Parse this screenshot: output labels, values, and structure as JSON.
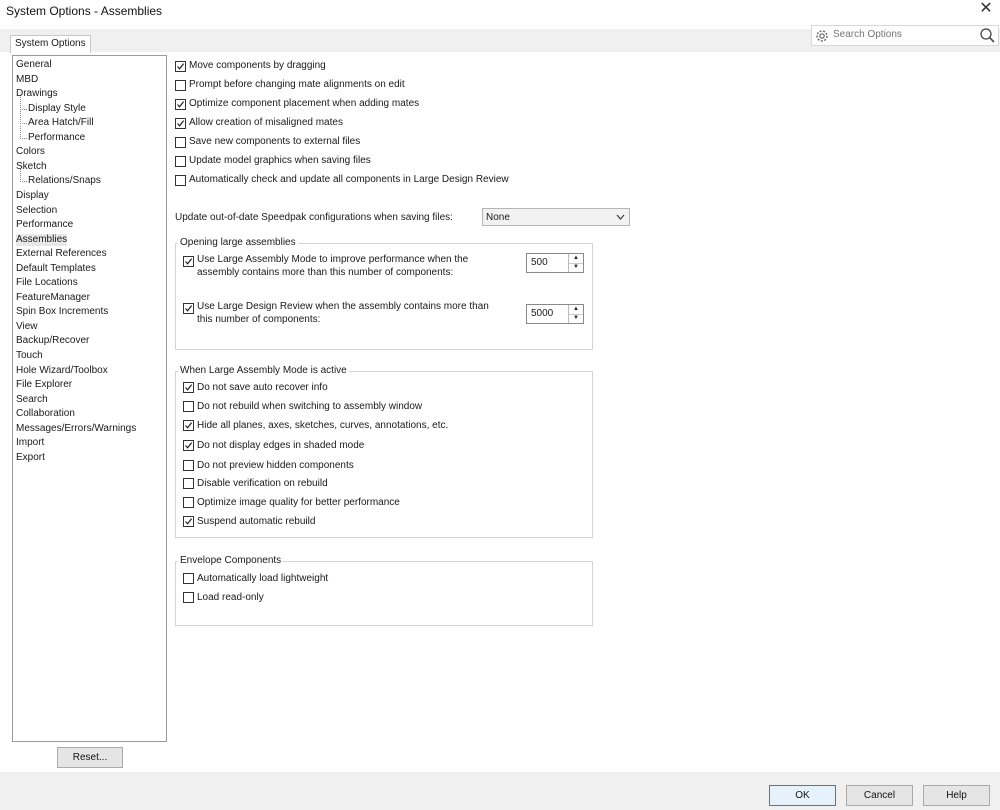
{
  "window": {
    "title": "System Options - Assemblies",
    "close_glyph": "✕"
  },
  "tab": {
    "label": "System Options"
  },
  "search": {
    "placeholder": "Search Options"
  },
  "tree": [
    {
      "label": "General",
      "sub": false,
      "selected": false
    },
    {
      "label": "MBD",
      "sub": false,
      "selected": false
    },
    {
      "label": "Drawings",
      "sub": false,
      "selected": false
    },
    {
      "label": "Display Style",
      "sub": true,
      "selected": false
    },
    {
      "label": "Area Hatch/Fill",
      "sub": true,
      "selected": false
    },
    {
      "label": "Performance",
      "sub": true,
      "selected": false
    },
    {
      "label": "Colors",
      "sub": false,
      "selected": false
    },
    {
      "label": "Sketch",
      "sub": false,
      "selected": false
    },
    {
      "label": "Relations/Snaps",
      "sub": true,
      "selected": false
    },
    {
      "label": "Display",
      "sub": false,
      "selected": false
    },
    {
      "label": "Selection",
      "sub": false,
      "selected": false
    },
    {
      "label": "Performance",
      "sub": false,
      "selected": false
    },
    {
      "label": "Assemblies",
      "sub": false,
      "selected": true
    },
    {
      "label": "External References",
      "sub": false,
      "selected": false
    },
    {
      "label": "Default Templates",
      "sub": false,
      "selected": false
    },
    {
      "label": "File Locations",
      "sub": false,
      "selected": false
    },
    {
      "label": "FeatureManager",
      "sub": false,
      "selected": false
    },
    {
      "label": "Spin Box Increments",
      "sub": false,
      "selected": false
    },
    {
      "label": "View",
      "sub": false,
      "selected": false
    },
    {
      "label": "Backup/Recover",
      "sub": false,
      "selected": false
    },
    {
      "label": "Touch",
      "sub": false,
      "selected": false
    },
    {
      "label": "Hole Wizard/Toolbox",
      "sub": false,
      "selected": false
    },
    {
      "label": "File Explorer",
      "sub": false,
      "selected": false
    },
    {
      "label": "Search",
      "sub": false,
      "selected": false
    },
    {
      "label": "Collaboration",
      "sub": false,
      "selected": false
    },
    {
      "label": "Messages/Errors/Warnings",
      "sub": false,
      "selected": false
    },
    {
      "label": "Import",
      "sub": false,
      "selected": false
    },
    {
      "label": "Export",
      "sub": false,
      "selected": false
    }
  ],
  "top_options": [
    {
      "label": "Move components by dragging",
      "checked": true
    },
    {
      "label": "Prompt before changing mate alignments on edit",
      "checked": false
    },
    {
      "label": "Optimize component placement when adding mates",
      "checked": true
    },
    {
      "label": "Allow creation of misaligned mates",
      "checked": true
    },
    {
      "label": "Save new components to external files",
      "checked": false
    },
    {
      "label": "Update model graphics when saving files",
      "checked": false
    },
    {
      "label": "Automatically check and update all components in Large Design Review",
      "checked": false
    }
  ],
  "speedpak": {
    "label": "Update out-of-date Speedpak configurations when saving files:",
    "value": "None"
  },
  "opening": {
    "title": "Opening large assemblies",
    "lam": {
      "line1": "Use Large Assembly Mode to improve performance when the",
      "line2": "assembly contains more than this number of components:",
      "checked": true,
      "value": "500"
    },
    "ldr": {
      "line1": "Use Large Design Review when the assembly contains more than",
      "line2": "this number of components:",
      "checked": true,
      "value": "5000"
    }
  },
  "lam_active": {
    "title": "When Large Assembly Mode is active",
    "items": [
      {
        "label": "Do not save auto recover info",
        "checked": true
      },
      {
        "label": "Do not rebuild when switching to assembly window",
        "checked": false
      },
      {
        "label": "Hide all planes, axes, sketches, curves, annotations, etc.",
        "checked": true
      },
      {
        "label": "Do not display edges in shaded mode",
        "checked": true
      },
      {
        "label": "Do not preview hidden components",
        "checked": false
      },
      {
        "label": "Disable verification on rebuild",
        "checked": false
      },
      {
        "label": "Optimize image quality for better performance",
        "checked": false
      },
      {
        "label": "Suspend automatic rebuild",
        "checked": true
      }
    ]
  },
  "envelope": {
    "title": "Envelope Components",
    "items": [
      {
        "label": "Automatically load lightweight",
        "checked": false
      },
      {
        "label": "Load read-only",
        "checked": false
      }
    ]
  },
  "buttons": {
    "reset": "Reset...",
    "ok": "OK",
    "cancel": "Cancel",
    "help": "Help"
  }
}
